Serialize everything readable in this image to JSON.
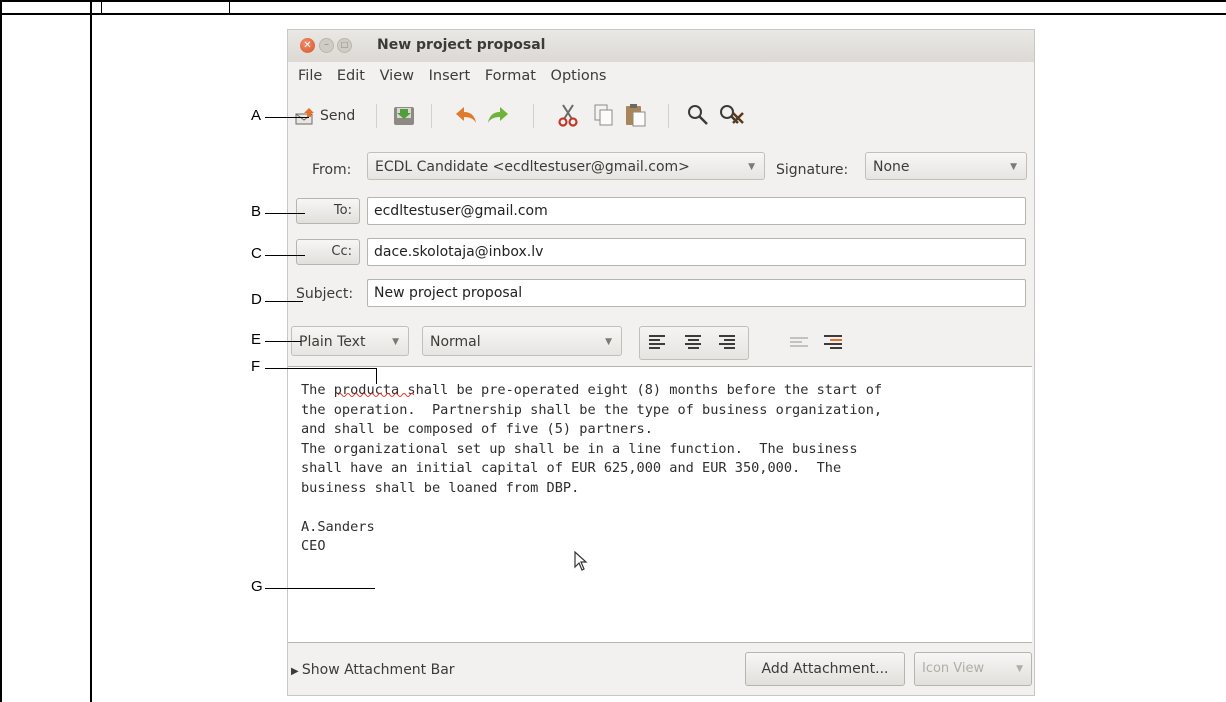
{
  "window": {
    "title": "New project proposal",
    "menus": [
      "File",
      "Edit",
      "View",
      "Insert",
      "Format",
      "Options"
    ]
  },
  "toolbar": {
    "send_label": "Send",
    "icons": [
      "send-icon",
      "save-icon",
      "undo-icon",
      "redo-icon",
      "cut-icon",
      "copy-icon",
      "paste-icon",
      "find-icon",
      "replace-icon"
    ]
  },
  "headers": {
    "from_label": "From:",
    "from_value": "ECDL Candidate <ecdltestuser@gmail.com>",
    "signature_label": "Signature:",
    "signature_value": "None",
    "to_button": "To:",
    "to_value": "ecdltestuser@gmail.com",
    "cc_button": "Cc:",
    "cc_value": "dace.skolotaja@inbox.lv",
    "subject_label": "Subject:",
    "subject_value": "New project proposal"
  },
  "format": {
    "mode": "Plain Text",
    "paragraph_style": "Normal",
    "alignment_icons": [
      "align-left-icon",
      "align-center-icon",
      "align-right-icon",
      "outdent-icon",
      "indent-icon"
    ]
  },
  "message": {
    "lines": [
      "The producta shall be pre-operated eight (8) months before the start of",
      "the operation.  Partnership shall be the type of business organization,",
      "and shall be composed of five (5) partners.",
      "The organizational set up shall be in a line function.  The business",
      "shall have an initial capital of EUR 625,000 and EUR 350,000.  The",
      "business shall be loaned from DBP.",
      "",
      "A.Sanders",
      "CEO"
    ]
  },
  "footer": {
    "attachment_bar": "Show Attachment Bar",
    "add_attachment": "Add Attachment...",
    "icon_view": "Icon View"
  },
  "callouts": [
    "A",
    "B",
    "C",
    "D",
    "E",
    "F",
    "G"
  ],
  "colors": {
    "window_bg": "#f2f1f0",
    "close_button": "#dd5a2f",
    "text": "#3c3b37"
  }
}
